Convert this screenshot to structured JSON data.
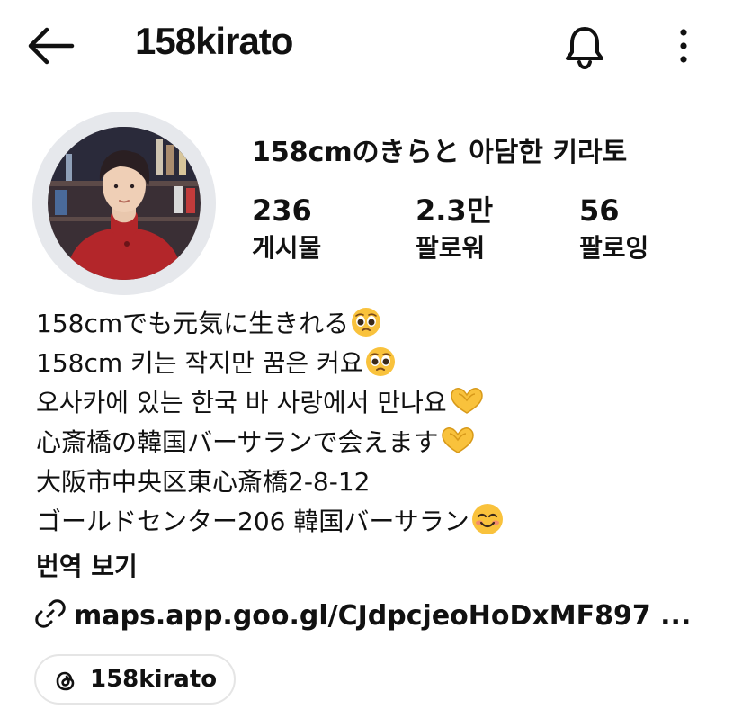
{
  "header": {
    "username": "158kirato",
    "back_icon": "arrow-left-icon",
    "notification_icon": "bell-icon",
    "more_icon": "vertical-dots-icon"
  },
  "profile": {
    "display_name": "158cmのきらと 아담한 키라토",
    "stats": [
      {
        "count": "236",
        "label": "게시물"
      },
      {
        "count": "2.3만",
        "label": "팔로워"
      },
      {
        "count": "56",
        "label": "팔로잉"
      }
    ]
  },
  "bio": {
    "lines": [
      {
        "text": "158cmでも元気に生きれる",
        "emoji": "pleading-face"
      },
      {
        "text": "158cm 키는 작지만 꿈은 커요",
        "emoji": "pleading-face"
      },
      {
        "text": "오사카에 있는 한국 바 사랑에서 만나요",
        "emoji": "heart-hands"
      },
      {
        "text": "心斎橋の韓国バーサランで会えます",
        "emoji": "heart-hands"
      },
      {
        "text": "大阪市中央区東心斎橋2-8-12",
        "emoji": ""
      },
      {
        "text": "ゴールドセンター206 韓国バーサラン",
        "emoji": "smiling-face"
      }
    ],
    "translate_label": "번역 보기"
  },
  "link": {
    "text": "maps.app.goo.gl/CJdpcjeoHoDxMF897 ...",
    "icon": "link-icon"
  },
  "threads": {
    "handle": "158kirato",
    "icon": "threads-icon"
  },
  "colors": {
    "text": "#111111",
    "avatar_ring": "#e6e8ec",
    "pill_border": "#e5e5e5",
    "emoji_yellow": "#f9c23c"
  }
}
